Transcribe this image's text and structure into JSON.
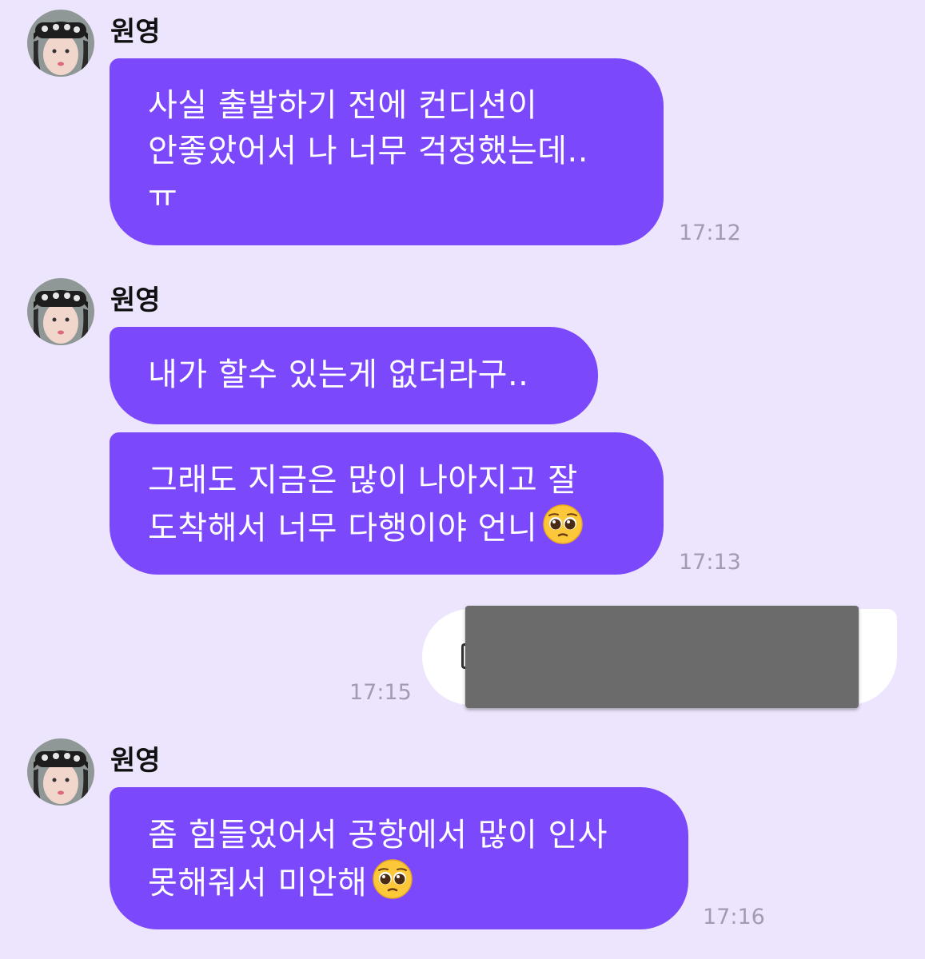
{
  "colors": {
    "background": "#ede5fd",
    "bubble_incoming": "#7b48fb",
    "bubble_outgoing": "#ffffff",
    "redaction": "#6b6b6b",
    "timestamp": "#a39bb2"
  },
  "groups": [
    {
      "sender": "원영",
      "messages": [
        {
          "lines": [
            "사실 출발하기 전에 컨디션이",
            "안좋았어서 나 너무 걱정했는데..",
            "ㅠ"
          ]
        }
      ],
      "time": "17:12"
    },
    {
      "sender": "원영",
      "messages": [
        {
          "lines": [
            "내가 할수 있는게 없더라구.."
          ]
        },
        {
          "lines": [
            "그래도 지금은 많이 나아지고 잘",
            "도착해서 너무 다행이야 언니"
          ],
          "emoji": "pleading-face-icon"
        }
      ],
      "time": "17:13"
    },
    {
      "outgoing": true,
      "content": "redacted",
      "time": "17:15"
    },
    {
      "sender": "원영",
      "messages": [
        {
          "lines": [
            "좀 힘들었어서 공항에서 많이 인사",
            "못해줘서 미안해"
          ],
          "emoji": "pleading-face-icon"
        }
      ],
      "time": "17:16"
    }
  ]
}
